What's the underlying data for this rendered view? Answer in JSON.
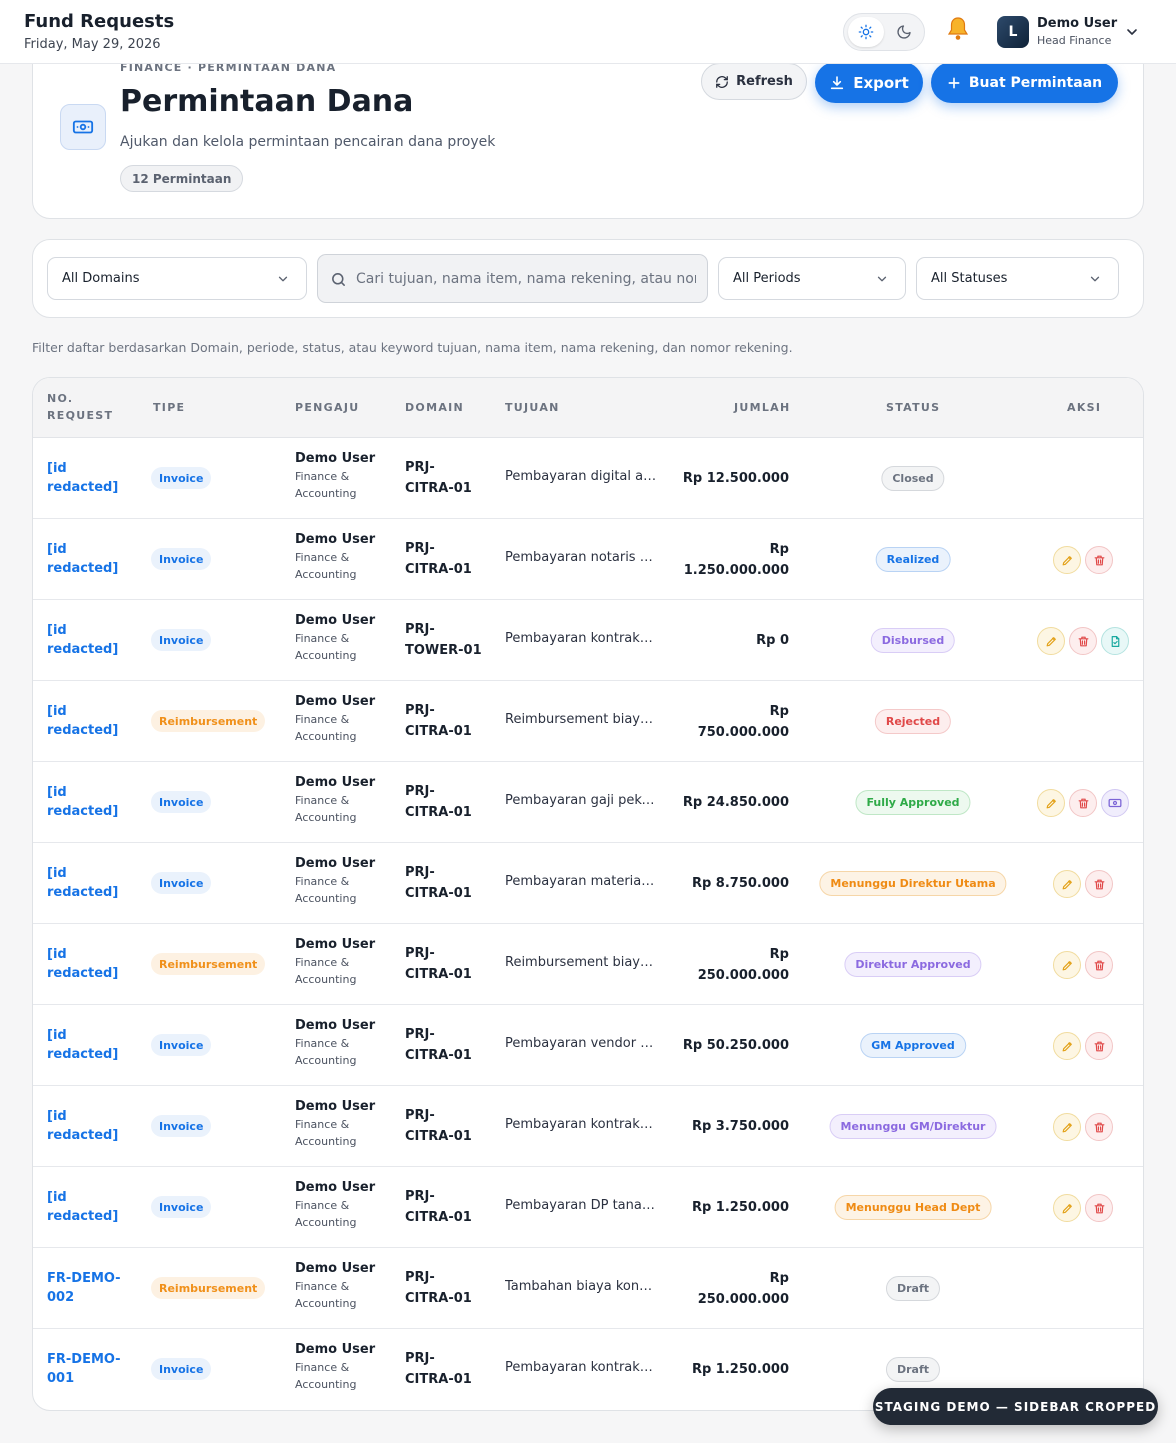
{
  "topbar": {
    "title": "Fund Requests",
    "date": "Friday, May 29, 2026",
    "user": {
      "initial": "L",
      "name": "Demo User",
      "role": "Head Finance"
    },
    "icons": [
      "sun-icon",
      "moon-icon",
      "bell-icon",
      "chevron-down-icon"
    ]
  },
  "header": {
    "eyebrow": "FINANCE · PERMINTAAN DANA",
    "title": "Permintaan Dana",
    "subtitle": "Ajukan dan kelola permintaan pencairan dana proyek",
    "count": "12 Permintaan",
    "refresh_label": "Refresh",
    "export_label": "Export",
    "create_label": "Buat Permintaan"
  },
  "filters": {
    "domain": "All Domains",
    "search_placeholder": "Cari tujuan, nama item, nama rekening, atau nomor rekening",
    "period": "All Periods",
    "status": "All Statuses",
    "hint": "Filter daftar berdasarkan Domain, periode, status, atau keyword tujuan, nama item, nama rekening, dan nomor rekening."
  },
  "table": {
    "headers": {
      "no_request_1": "NO.",
      "no_request_2": "REQUEST",
      "type": "TIPE",
      "requester": "PENGAJU",
      "domain": "DOMAIN",
      "purpose": "TUJUAN",
      "amount": "JUMLAH",
      "status": "STATUS",
      "action": "AKSI"
    },
    "rows": [
      {
        "id_1": "[id",
        "id_2": "redacted]",
        "type": "Invoice",
        "user": "Demo User",
        "dept_1": "Finance &",
        "dept_2": "Accounting",
        "domain_1": "PRJ-",
        "domain_2": "CITRA-01",
        "purpose": "Pembayaran digital agency",
        "amount_1": "Rp 12.500.000",
        "amount_2": "",
        "status": "Closed"
      },
      {
        "id_1": "[id",
        "id_2": "redacted]",
        "type": "Invoice",
        "user": "Demo User",
        "dept_1": "Finance &",
        "dept_2": "Accounting",
        "domain_1": "PRJ-",
        "domain_2": "CITRA-01",
        "purpose": "Pembayaran notaris dan PPAT",
        "amount_1": "Rp",
        "amount_2": "1.250.000.000",
        "status": "Realized"
      },
      {
        "id_1": "[id",
        "id_2": "redacted]",
        "type": "Invoice",
        "user": "Demo User",
        "dept_1": "Finance &",
        "dept_2": "Accounting",
        "domain_1": "PRJ-",
        "domain_2": "TOWER-01",
        "purpose": "Pembayaran kontraktor utama",
        "amount_1": "Rp 0",
        "amount_2": "",
        "status": "Disbursed"
      },
      {
        "id_1": "[id",
        "id_2": "redacted]",
        "type": "Reimbursement",
        "user": "Demo User",
        "dept_1": "Finance &",
        "dept_2": "Accounting",
        "domain_1": "PRJ-",
        "domain_2": "CITRA-01",
        "purpose": "Reimbursement biaya perjalanan",
        "amount_1": "Rp",
        "amount_2": "750.000.000",
        "status": "Rejected"
      },
      {
        "id_1": "[id",
        "id_2": "redacted]",
        "type": "Invoice",
        "user": "Demo User",
        "dept_1": "Finance &",
        "dept_2": "Accounting",
        "domain_1": "PRJ-",
        "domain_2": "CITRA-01",
        "purpose": "Pembayaran gaji pekerja",
        "amount_1": "Rp 24.850.000",
        "amount_2": "",
        "status": "Fully Approved"
      },
      {
        "id_1": "[id",
        "id_2": "redacted]",
        "type": "Invoice",
        "user": "Demo User",
        "dept_1": "Finance &",
        "dept_2": "Accounting",
        "domain_1": "PRJ-",
        "domain_2": "CITRA-01",
        "purpose": "Pembayaran material bangunan",
        "amount_1": "Rp 8.750.000",
        "amount_2": "",
        "status": "Menunggu Direktur Utama"
      },
      {
        "id_1": "[id",
        "id_2": "redacted]",
        "type": "Reimbursement",
        "user": "Demo User",
        "dept_1": "Finance &",
        "dept_2": "Accounting",
        "domain_1": "PRJ-",
        "domain_2": "CITRA-01",
        "purpose": "Reimbursement biaya operasional",
        "amount_1": "Rp",
        "amount_2": "250.000.000",
        "status": "Direktur Approved"
      },
      {
        "id_1": "[id",
        "id_2": "redacted]",
        "type": "Invoice",
        "user": "Demo User",
        "dept_1": "Finance &",
        "dept_2": "Accounting",
        "domain_1": "PRJ-",
        "domain_2": "CITRA-01",
        "purpose": "Pembayaran vendor konsultan",
        "amount_1": "Rp 50.250.000",
        "amount_2": "",
        "status": "GM Approved"
      },
      {
        "id_1": "[id",
        "id_2": "redacted]",
        "type": "Invoice",
        "user": "Demo User",
        "dept_1": "Finance &",
        "dept_2": "Accounting",
        "domain_1": "PRJ-",
        "domain_2": "CITRA-01",
        "purpose": "Pembayaran kontraktor sipil",
        "amount_1": "Rp 3.750.000",
        "amount_2": "",
        "status": "Menunggu GM/Direktur"
      },
      {
        "id_1": "[id",
        "id_2": "redacted]",
        "type": "Invoice",
        "user": "Demo User",
        "dept_1": "Finance &",
        "dept_2": "Accounting",
        "domain_1": "PRJ-",
        "domain_2": "CITRA-01",
        "purpose": "Pembayaran DP tanah proyek",
        "amount_1": "Rp 1.250.000",
        "amount_2": "",
        "status": "Menunggu Head Dept"
      },
      {
        "id_1": "FR-DEMO-",
        "id_2": "002",
        "type": "Reimbursement",
        "user": "Demo User",
        "dept_1": "Finance &",
        "dept_2": "Accounting",
        "domain_1": "PRJ-",
        "domain_2": "CITRA-01",
        "purpose": "Tambahan biaya konsultan",
        "amount_1": "Rp",
        "amount_2": "250.000.000",
        "status": "Draft"
      },
      {
        "id_1": "FR-DEMO-",
        "id_2": "001",
        "type": "Invoice",
        "user": "Demo User",
        "dept_1": "Finance &",
        "dept_2": "Accounting",
        "domain_1": "PRJ-",
        "domain_2": "CITRA-01",
        "purpose": "Pembayaran kontraktor utama",
        "amount_1": "Rp 1.250.000",
        "amount_2": "",
        "status": "Draft"
      }
    ]
  },
  "staging_badge": "STAGING DEMO — SIDEBAR CROPPED"
}
